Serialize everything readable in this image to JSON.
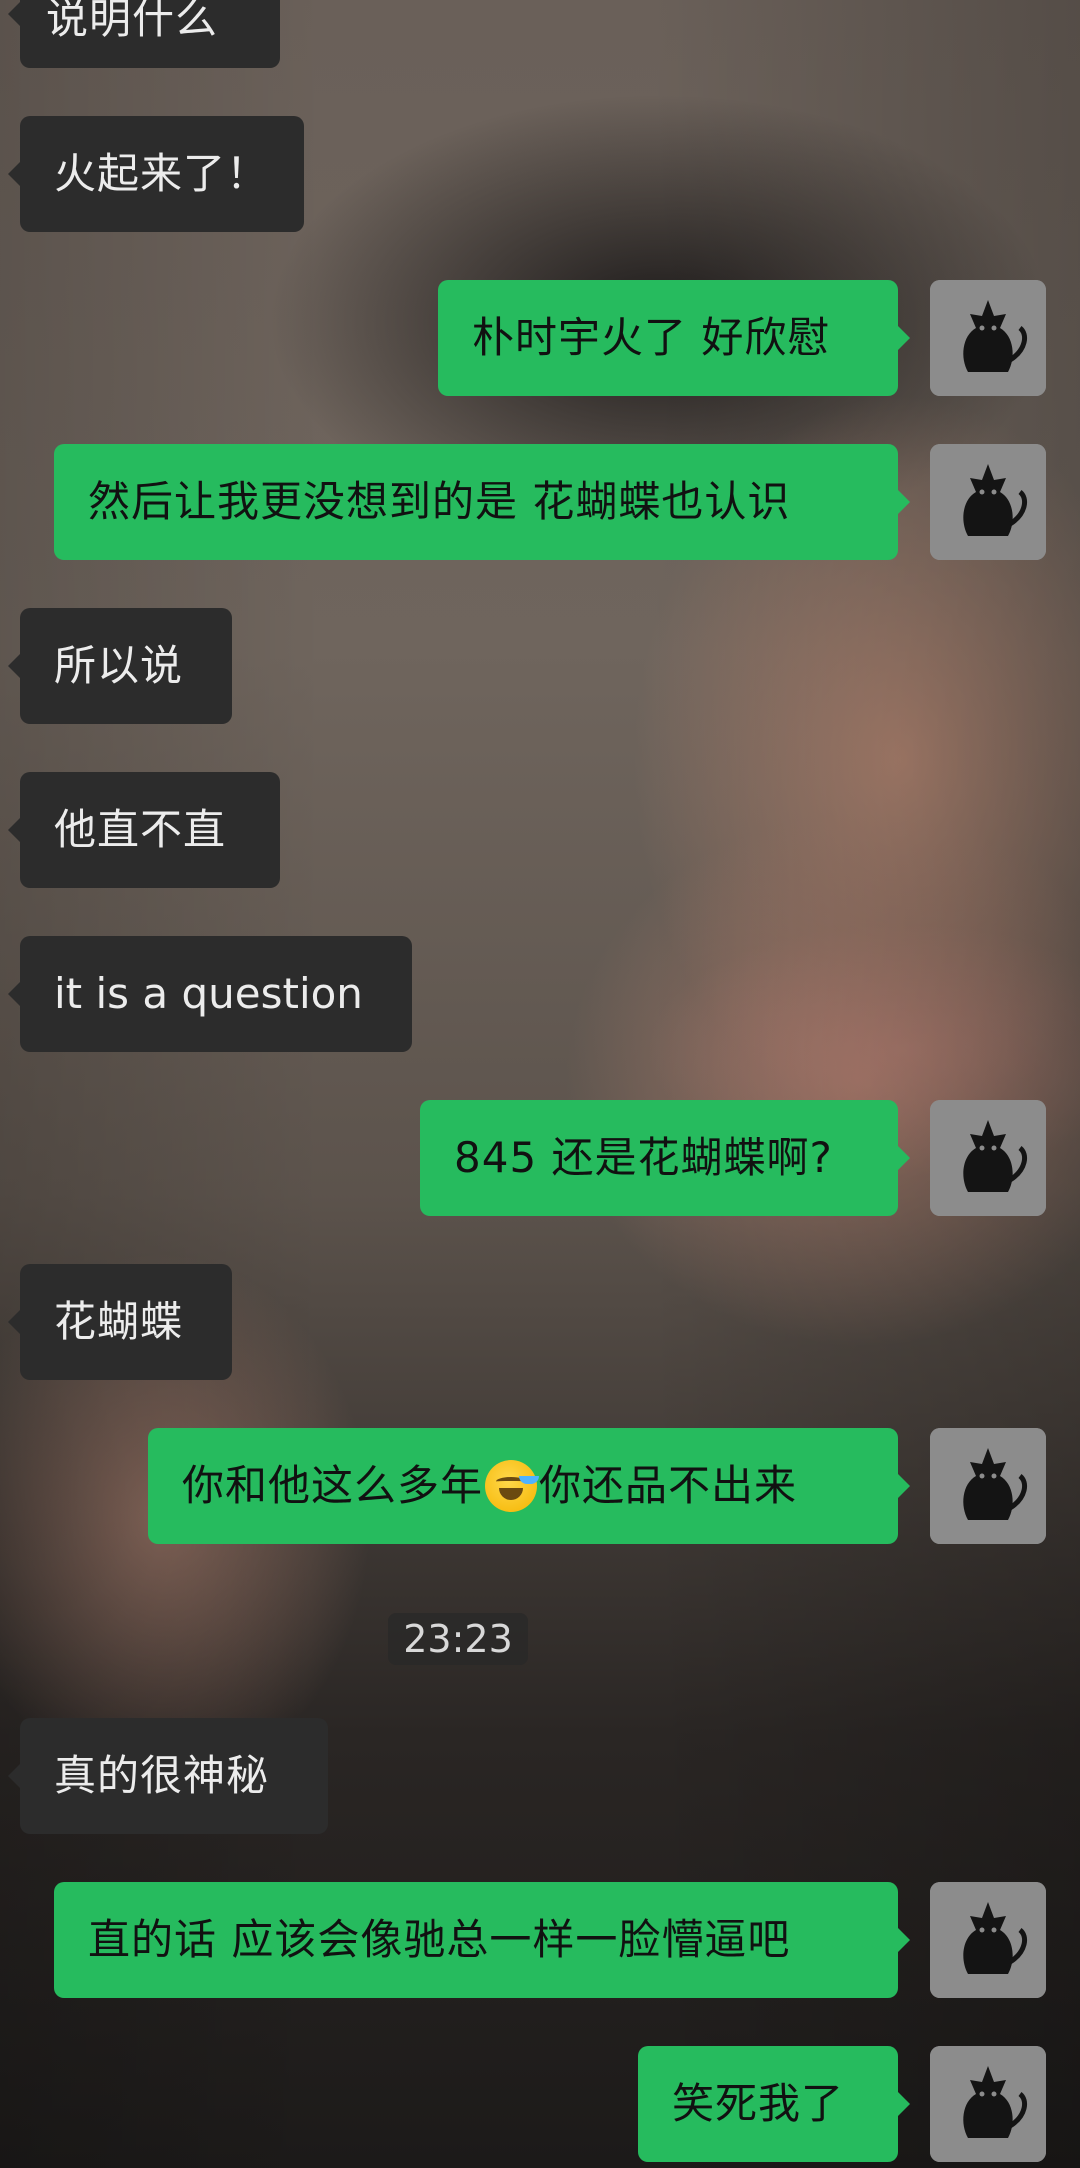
{
  "messages": [
    {
      "side": "left",
      "text": "说明什么"
    },
    {
      "side": "left",
      "text": "火起来了！"
    },
    {
      "side": "right",
      "text": "朴时宇火了 好欣慰"
    },
    {
      "side": "right",
      "text": "然后让我更没想到的是 花蝴蝶也认识"
    },
    {
      "side": "left",
      "text": "所以说"
    },
    {
      "side": "left",
      "text": "他直不直"
    },
    {
      "side": "left",
      "text": "it is a question"
    },
    {
      "side": "right",
      "text": "845 还是花蝴蝶啊?"
    },
    {
      "side": "left",
      "text": "花蝴蝶"
    },
    {
      "side": "right",
      "text_before_emoji": "你和他这么多年",
      "emoji": "face-with-tears-of-joy",
      "text_after_emoji": "你还品不出来"
    },
    {
      "side": "left",
      "text": "真的很神秘"
    },
    {
      "side": "right",
      "text": "直的话 应该会像驰总一样一脸懵逼吧"
    },
    {
      "side": "right",
      "text": "笑死我了"
    }
  ],
  "timestamp": "23:23",
  "avatar": {
    "icon": "black-cat-icon"
  },
  "colors": {
    "incoming_bubble": "#2c2c2c",
    "outgoing_bubble": "#26bb5e",
    "incoming_text": "#ececec",
    "outgoing_text": "#111111"
  }
}
